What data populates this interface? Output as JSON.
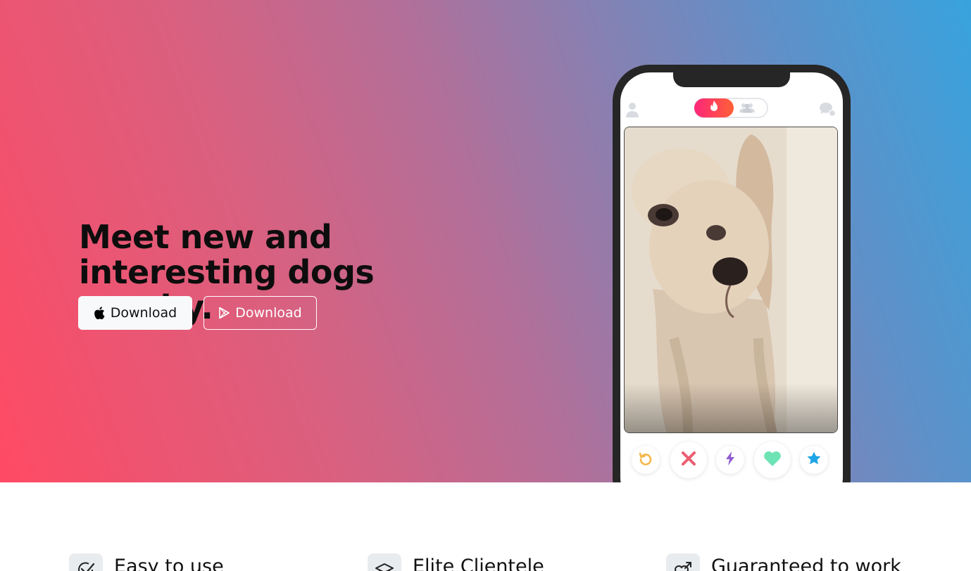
{
  "hero": {
    "headline": "Meet new and interesting dogs nearby.",
    "buttons": {
      "apple": {
        "label": "Download",
        "icon": "apple-icon"
      },
      "play": {
        "label": "Download",
        "icon": "play-store-icon"
      }
    }
  },
  "phone": {
    "topbar": {
      "left_icon": "profile-icon",
      "toggle_active_icon": "flame-icon",
      "toggle_inactive_icon": "group-icon",
      "right_icon": "chat-icon"
    },
    "card": {
      "image": "dog-photo"
    },
    "actions": [
      {
        "name": "rewind",
        "icon": "rewind-icon",
        "color": "#f5b748"
      },
      {
        "name": "nope",
        "icon": "close-icon",
        "color": "#ec5e6f"
      },
      {
        "name": "boost",
        "icon": "bolt-icon",
        "color": "#915dd1"
      },
      {
        "name": "like",
        "icon": "heart-icon",
        "color": "#6ee3b4"
      },
      {
        "name": "super-like",
        "icon": "star-icon",
        "color": "#1ea5e6"
      }
    ]
  },
  "features": [
    {
      "title": "Easy to use",
      "icon": "check-circle-icon"
    },
    {
      "title": "Elite Clientele",
      "icon": "graduation-cap-icon"
    },
    {
      "title": "Guaranteed to work",
      "icon": "heart-arrow-icon"
    }
  ],
  "colors": {
    "gradient_start": "#ff4a64",
    "gradient_end": "#38a3dd",
    "phone_frame": "#262626"
  }
}
